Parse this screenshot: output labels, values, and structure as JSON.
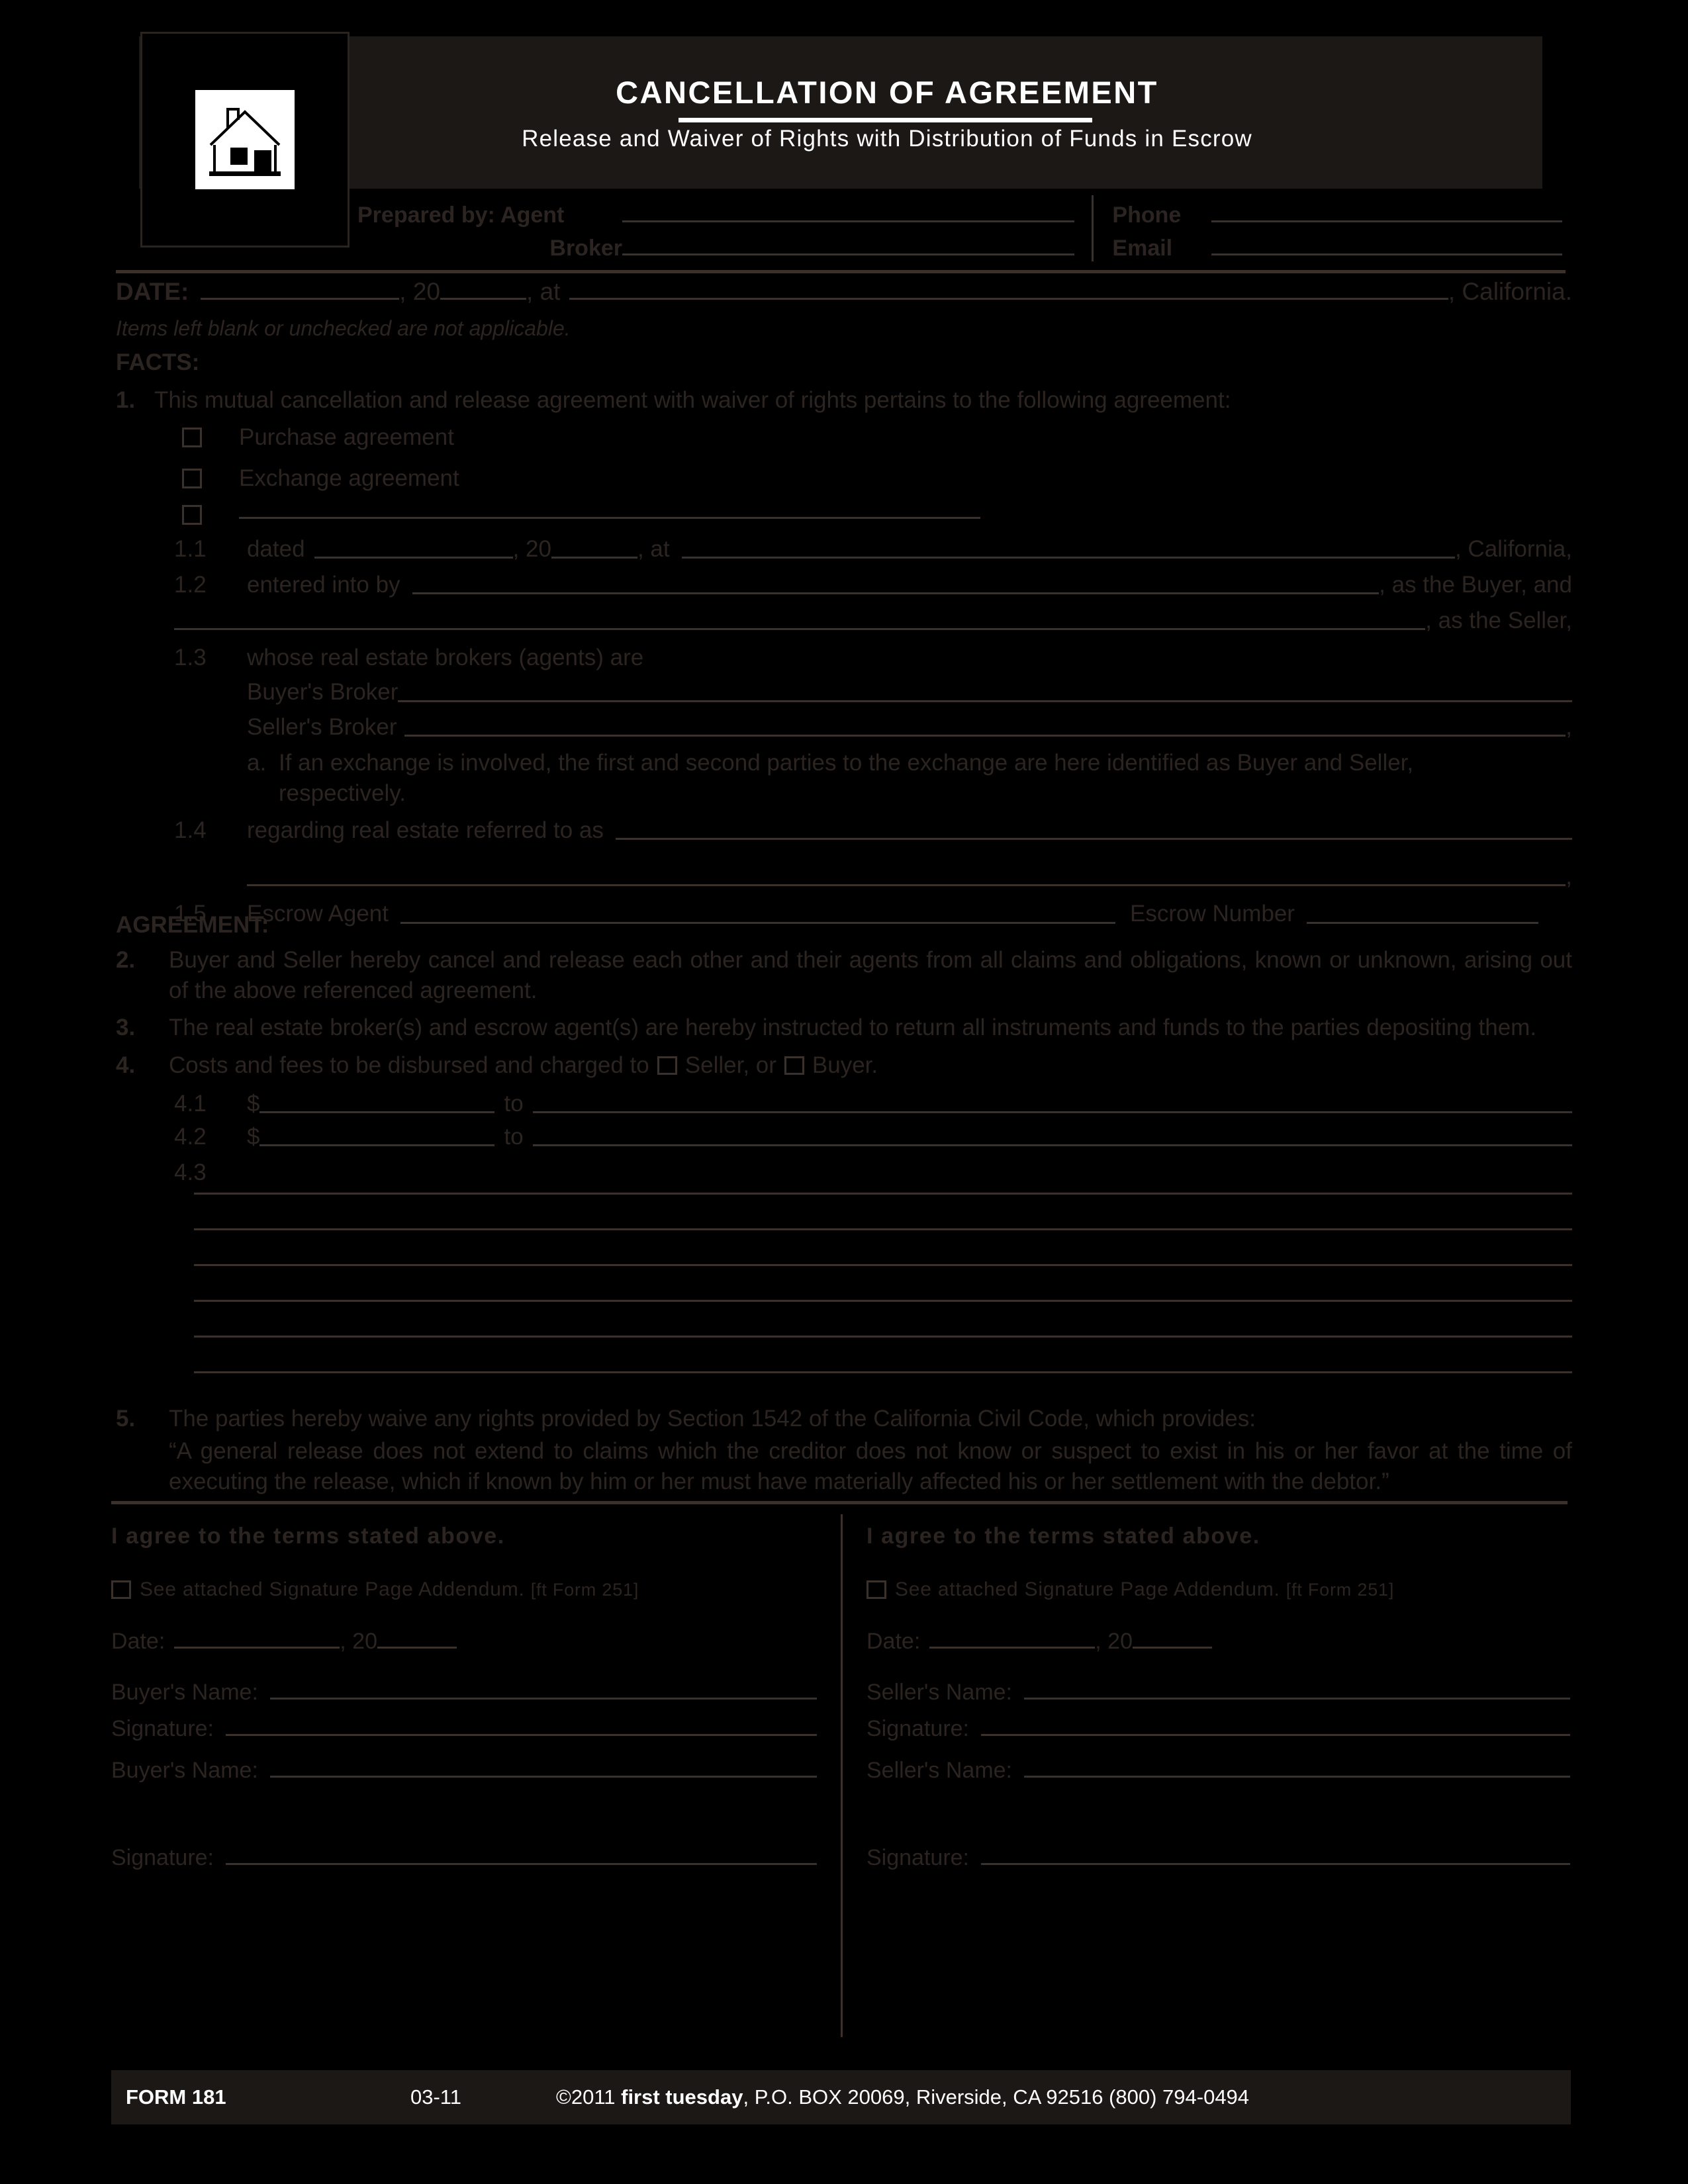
{
  "header": {
    "title": "CANCELLATION  OF  AGREEMENT",
    "subtitle": "Release  and  Waiver  of  Rights  with  Distribution  of  Funds  in  Escrow",
    "logo_icon": "house-icon"
  },
  "prepared_by": {
    "agent_label": "Prepared by: Agent",
    "broker_label": "Broker",
    "phone_label": "Phone",
    "email_label": "Email"
  },
  "dateline": {
    "date_label": "DATE:",
    "year_prefix": ", 20",
    "at_label": ", at",
    "state_suffix": ", California.",
    "note": "Items left blank or unchecked are not applicable."
  },
  "facts": {
    "heading": "FACTS:",
    "item1": {
      "num": "1.",
      "text": "This mutual cancellation and release agreement with waiver of rights pertains to the following agreement:",
      "checkboxes": [
        "Purchase agreement",
        "Exchange agreement",
        ""
      ],
      "sub": {
        "1_1": {
          "num": "1.1",
          "label": "dated",
          "year_prefix": ", 20",
          "at_label": ",  at",
          "state_suffix": ", California,"
        },
        "1_2": {
          "num": "1.2",
          "label": "entered into by",
          "buyer_suffix": ", as the Buyer, and",
          "seller_suffix": ", as the Seller,"
        },
        "1_3": {
          "num": "1.3",
          "label": "whose real estate brokers (agents) are",
          "buyers_broker": "Buyer's Broker",
          "sellers_broker": "Seller's Broker",
          "sellers_broker_suffix": ",",
          "note_letter": "a.",
          "note_text": "If an exchange is involved, the  first and second parties to the exchange are here identified as Buyer and Seller, respectively."
        },
        "1_4": {
          "num": "1.4",
          "label": "regarding real estate referred to as",
          "end_suffix": ","
        },
        "1_5": {
          "num": "1.5",
          "escrow_agent_label": "Escrow Agent",
          "escrow_number_label": "Escrow Number"
        }
      }
    }
  },
  "agreement": {
    "heading": "AGREEMENT:",
    "item2": {
      "num": "2.",
      "text": "Buyer and Seller hereby cancel and release each other and their agents from all claims and obligations, known or unknown, arising out of the above referenced agreement."
    },
    "item3": {
      "num": "3.",
      "text": "The real estate broker(s) and escrow agent(s) are hereby instructed to return all instruments and funds to the parties depositing them."
    },
    "item4": {
      "num": "4.",
      "text_before": "Costs and fees to be disbursed and charged to",
      "seller_option": "Seller, or",
      "buyer_option": "Buyer.",
      "sub": {
        "4_1": {
          "num": "4.1",
          "dollar": "$",
          "to": "to"
        },
        "4_2": {
          "num": "4.2",
          "dollar": "$",
          "to": "to"
        },
        "4_3": {
          "num": "4.3",
          "blank_line_count": 6
        }
      }
    },
    "item5": {
      "num": "5.",
      "text": "The parties hereby waive any rights provided by Section 1542 of the California Civil Code, which provides:",
      "quote": "“A general release does not extend to claims which the creditor does not know or suspect to exist in his or her favor at the time of executing the release, which if known by him or her must have materially affected his or her settlement with the debtor.”"
    }
  },
  "signatures": {
    "buyer": {
      "agree": "I  agree  to  the  terms  stated  above.",
      "attach_text": "See  attached  Signature  Page  Addendum.",
      "attach_form": "[ft  Form  251]",
      "date_label": "Date:",
      "year_prefix": ", 20",
      "name_label": "Buyer's  Name:",
      "signature_label": "Signature:",
      "name_label_2": "Buyer's  Name:",
      "signature_label_2": "Signature:"
    },
    "seller": {
      "agree": "I  agree  to  the  terms  stated  above.",
      "attach_text": "See  attached  Signature  Page  Addendum.",
      "attach_form": "[ft  Form  251]",
      "date_label": "Date:",
      "year_prefix": ", 20",
      "name_label": "Seller's  Name:",
      "signature_label": "Signature:",
      "name_label_2": "Seller's  Name:",
      "signature_label_2": "Signature:"
    }
  },
  "footer": {
    "form_number": "FORM 181",
    "revision": "03-11",
    "copyright_prefix": "©2011 ",
    "brand": "first tuesday",
    "copyright_suffix": ", P.O. BOX 20069, Riverside, CA 92516  (800) 794-0494"
  },
  "colors": {
    "page_background": "#000000",
    "bar_background": "#1c1815",
    "text": "#2b2420",
    "rule": "#3a312c",
    "bar_text": "#ffffff"
  }
}
